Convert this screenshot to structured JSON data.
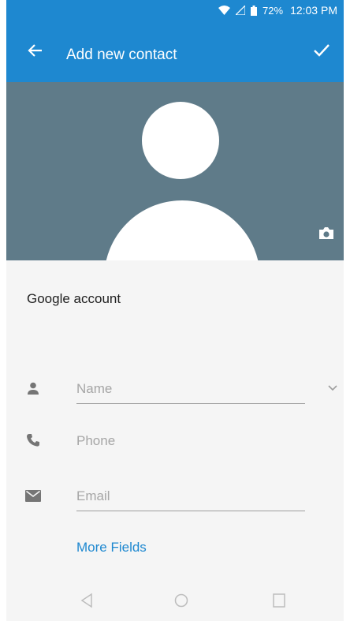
{
  "status_bar": {
    "battery_percent": "72%",
    "time": "12:03 PM"
  },
  "toolbar": {
    "title": "Add new contact",
    "back_icon": "arrow-left-icon",
    "save_icon": "check-icon"
  },
  "photo": {
    "placeholder_icon": "person-silhouette-icon",
    "camera_icon": "camera-icon"
  },
  "account": {
    "label": "Google account"
  },
  "fields": {
    "name": {
      "placeholder": "Name",
      "value": "",
      "icon": "person-icon"
    },
    "phone": {
      "placeholder": "Phone",
      "value": "",
      "icon": "phone-icon"
    },
    "email": {
      "placeholder": "Email",
      "value": "",
      "icon": "email-icon"
    }
  },
  "more_fields": {
    "label": "More Fields"
  },
  "navigation": {
    "back": "nav-back-icon",
    "home": "nav-home-icon",
    "recents": "nav-recents-icon"
  },
  "colors": {
    "app_bar": "#1e88d0",
    "photo_background": "#5f7b89",
    "accent": "#1e88d0",
    "page_background": "#f5f5f5"
  }
}
